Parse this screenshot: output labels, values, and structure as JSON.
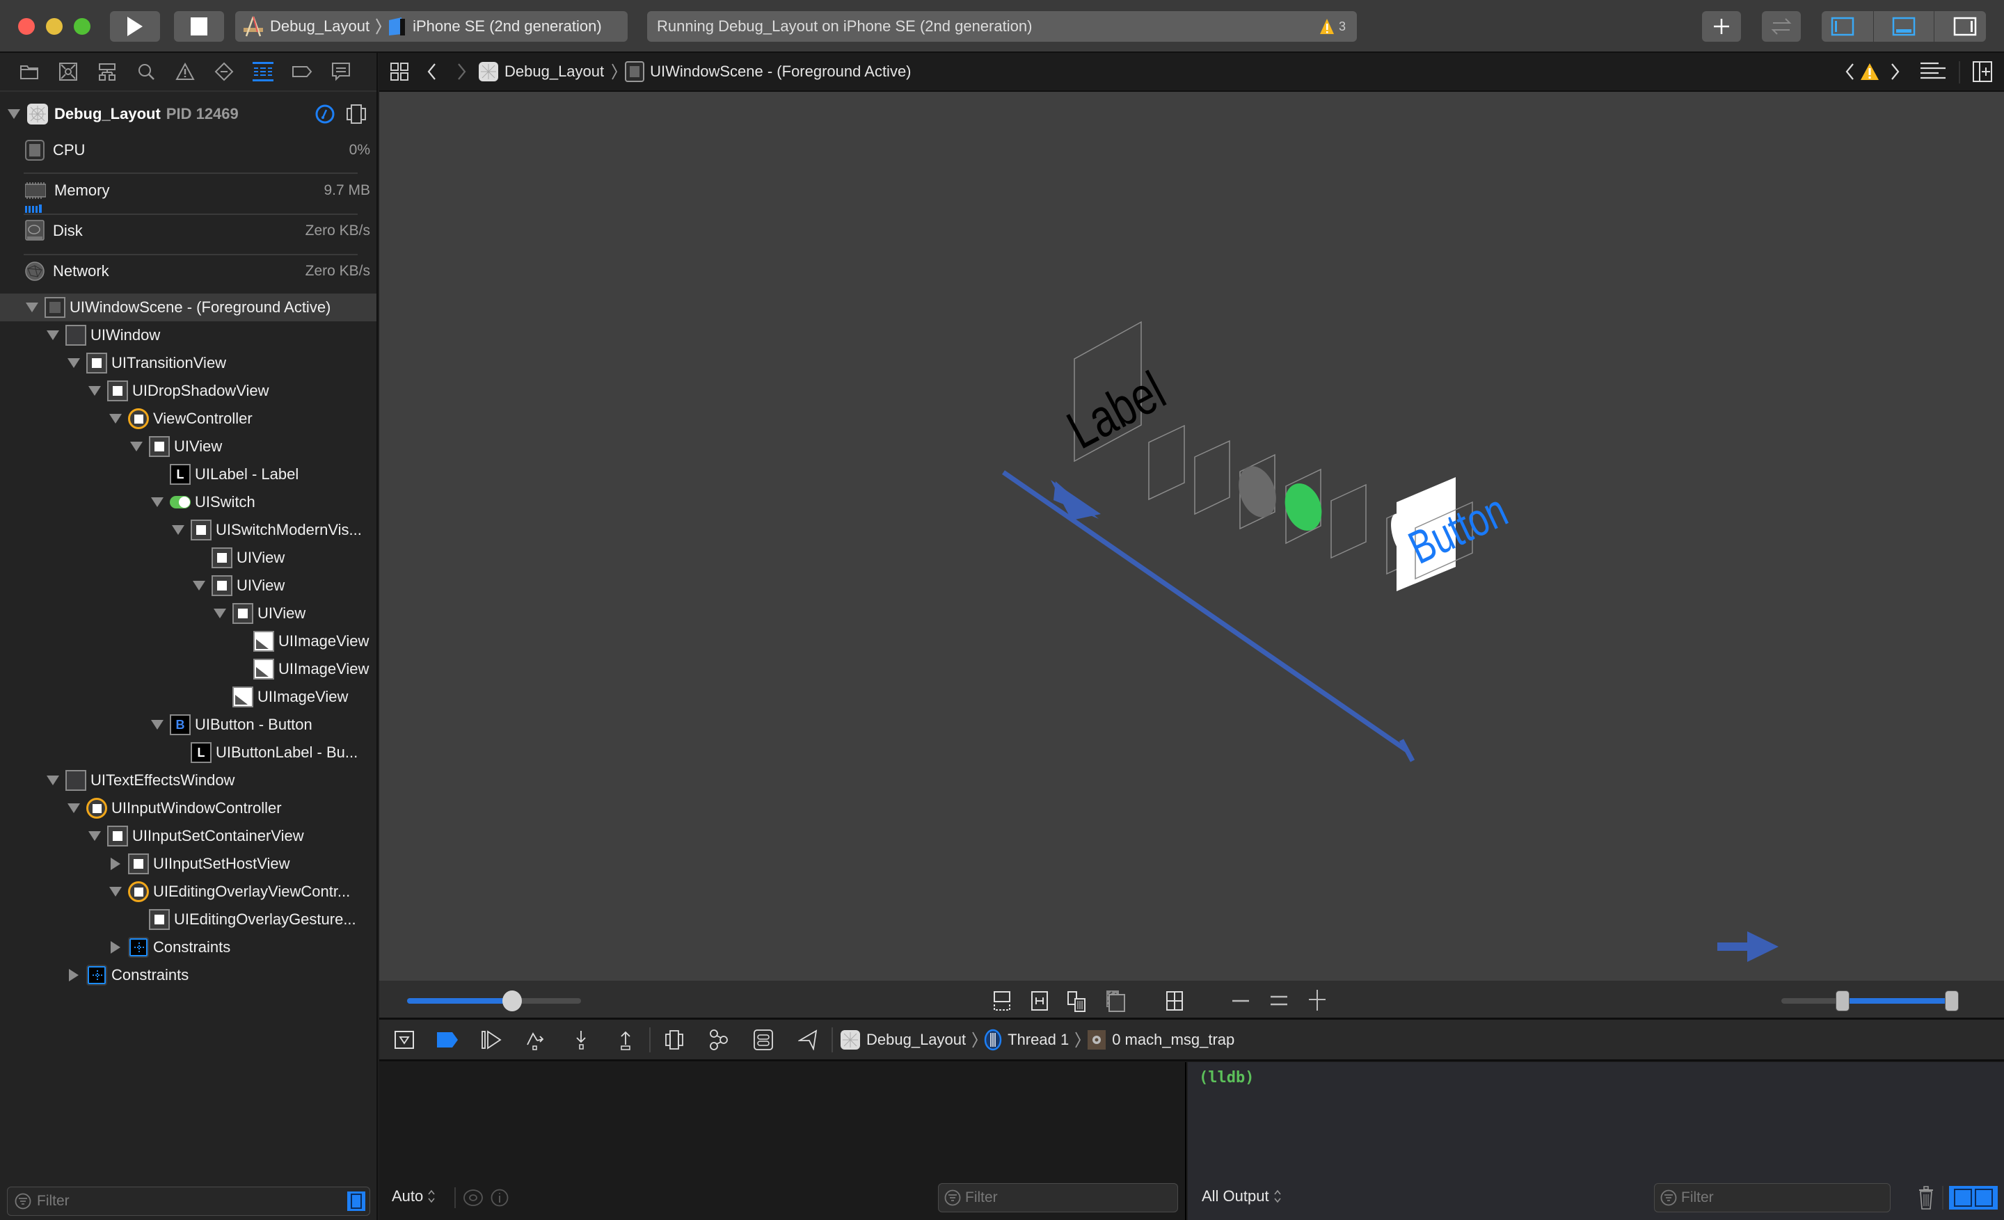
{
  "window": {
    "scheme": "Debug_Layout",
    "destination": "iPhone SE (2nd generation)",
    "status": "Running Debug_Layout on iPhone SE (2nd generation)",
    "warning_count": "3",
    "colors": {
      "accent": "#1d7ff5",
      "warning": "#f8b81c",
      "switch_on": "#5ec354",
      "lldb": "#5cc05a",
      "canvas_bg": "#404040"
    }
  },
  "navigator": {
    "tabs": [
      "project-navigator",
      "source-control",
      "symbol-navigator",
      "find-navigator",
      "issue-navigator",
      "test-navigator",
      "debug-navigator",
      "breakpoint-navigator",
      "report-navigator"
    ],
    "active_tab": "debug-navigator",
    "process": {
      "name": "Debug_Layout",
      "pid": "PID 12469"
    },
    "gauges": [
      {
        "label": "CPU",
        "value": "0%"
      },
      {
        "label": "Memory",
        "value": "9.7 MB"
      },
      {
        "label": "Disk",
        "value": "Zero KB/s"
      },
      {
        "label": "Network",
        "value": "Zero KB/s"
      }
    ],
    "tree": [
      {
        "label": "UIWindowScene - (Foreground Active)",
        "depth": 0,
        "icon": "scene",
        "disclosure": "open",
        "selected": true
      },
      {
        "label": "UIWindow",
        "depth": 1,
        "icon": "window",
        "disclosure": "open"
      },
      {
        "label": "UITransitionView",
        "depth": 2,
        "icon": "view",
        "disclosure": "open"
      },
      {
        "label": "UIDropShadowView",
        "depth": 3,
        "icon": "view",
        "disclosure": "open"
      },
      {
        "label": "ViewController",
        "depth": 4,
        "icon": "vc",
        "disclosure": "open"
      },
      {
        "label": "UIView",
        "depth": 5,
        "icon": "view",
        "disclosure": "open"
      },
      {
        "label": "UILabel - Label",
        "depth": 6,
        "icon": "label",
        "disclosure": "none"
      },
      {
        "label": "UISwitch",
        "depth": 6,
        "icon": "switch",
        "disclosure": "open"
      },
      {
        "label": "UISwitchModernVis...",
        "depth": 7,
        "icon": "view",
        "disclosure": "open"
      },
      {
        "label": "UIView",
        "depth": 8,
        "icon": "view",
        "disclosure": "none"
      },
      {
        "label": "UIView",
        "depth": 8,
        "icon": "view",
        "disclosure": "open"
      },
      {
        "label": "UIView",
        "depth": 9,
        "icon": "view",
        "disclosure": "open"
      },
      {
        "label": "UIImageView",
        "depth": 10,
        "icon": "image",
        "disclosure": "none"
      },
      {
        "label": "UIImageView",
        "depth": 10,
        "icon": "image",
        "disclosure": "none"
      },
      {
        "label": "UIImageView",
        "depth": 9,
        "icon": "image",
        "disclosure": "none"
      },
      {
        "label": "UIButton - Button",
        "depth": 6,
        "icon": "button",
        "disclosure": "open"
      },
      {
        "label": "UIButtonLabel - Bu...",
        "depth": 7,
        "icon": "label",
        "disclosure": "none"
      },
      {
        "label": "UITextEffectsWindow",
        "depth": 1,
        "icon": "window",
        "disclosure": "open"
      },
      {
        "label": "UIInputWindowController",
        "depth": 2,
        "icon": "vc",
        "disclosure": "open"
      },
      {
        "label": "UIInputSetContainerView",
        "depth": 3,
        "icon": "view",
        "disclosure": "open"
      },
      {
        "label": "UIInputSetHostView",
        "depth": 4,
        "icon": "view",
        "disclosure": "closed"
      },
      {
        "label": "UIEditingOverlayViewContr...",
        "depth": 4,
        "icon": "vc",
        "disclosure": "open"
      },
      {
        "label": "UIEditingOverlayGesture...",
        "depth": 5,
        "icon": "view",
        "disclosure": "none"
      },
      {
        "label": "Constraints",
        "depth": 4,
        "icon": "constraints",
        "disclosure": "closed"
      },
      {
        "label": "Constraints",
        "depth": 2,
        "icon": "constraints",
        "disclosure": "closed"
      }
    ],
    "filter_placeholder": "Filter"
  },
  "jumpbar": {
    "crumbs": [
      "Debug_Layout",
      "UIWindowScene - (Foreground Active)"
    ]
  },
  "canvas": {
    "label_text": "Label",
    "button_text": "Button",
    "spacing_slider": 0.5,
    "range_slider": {
      "min": 0.33,
      "max": 1.0
    }
  },
  "debugbar": {
    "crumbs": [
      "Debug_Layout",
      "Thread 1",
      "0 mach_msg_trap"
    ]
  },
  "console": {
    "variables_scope": "Auto",
    "output_scope": "All Output",
    "prompt": "(lldb)",
    "filter_placeholder": "Filter"
  }
}
